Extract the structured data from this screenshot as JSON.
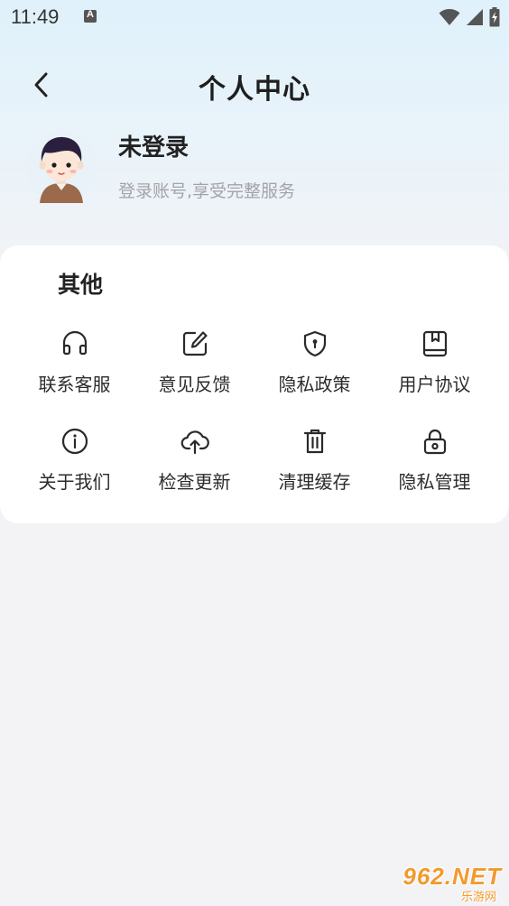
{
  "status_bar": {
    "time": "11:49"
  },
  "header": {
    "title": "个人中心"
  },
  "profile": {
    "name": "未登录",
    "subtitle": "登录账号,享受完整服务"
  },
  "others": {
    "title": "其他",
    "items": [
      {
        "label": "联系客服",
        "icon": "headset-icon"
      },
      {
        "label": "意见反馈",
        "icon": "edit-icon"
      },
      {
        "label": "隐私政策",
        "icon": "shield-icon"
      },
      {
        "label": "用户协议",
        "icon": "bookmark-book-icon"
      },
      {
        "label": "关于我们",
        "icon": "info-icon"
      },
      {
        "label": "检查更新",
        "icon": "cloud-upload-icon"
      },
      {
        "label": "清理缓存",
        "icon": "trash-icon"
      },
      {
        "label": "隐私管理",
        "icon": "lock-icon"
      }
    ]
  },
  "watermark": {
    "brand": "962.NET",
    "sub": "乐游网"
  },
  "colors": {
    "header_gradient_top": "#dff1fb",
    "background": "#f3f3f5",
    "card": "#ffffff",
    "muted_text": "#a3a3a7",
    "watermark": "#f29a2e"
  }
}
